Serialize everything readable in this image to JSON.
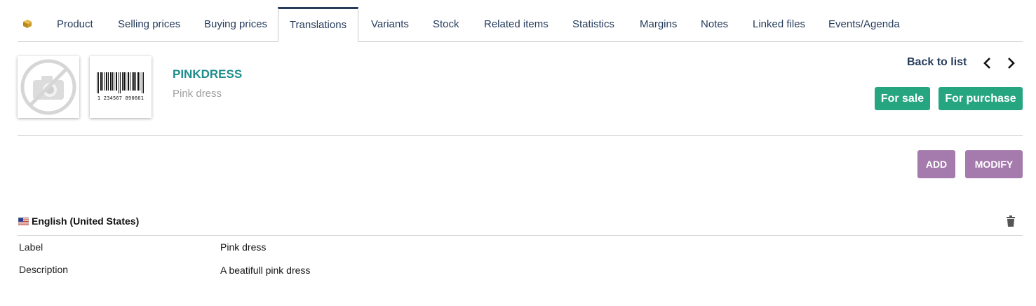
{
  "tabs": [
    {
      "label": "Product"
    },
    {
      "label": "Selling prices"
    },
    {
      "label": "Buying prices"
    },
    {
      "label": "Translations"
    },
    {
      "label": "Variants"
    },
    {
      "label": "Stock"
    },
    {
      "label": "Related items"
    },
    {
      "label": "Statistics"
    },
    {
      "label": "Margins"
    },
    {
      "label": "Notes"
    },
    {
      "label": "Linked files"
    },
    {
      "label": "Events/Agenda"
    }
  ],
  "active_tab": "Translations",
  "product": {
    "ref": "PINKDRESS",
    "label": "Pink dress",
    "barcode_digits": "1 234567 890661"
  },
  "navigation": {
    "back_label": "Back to list"
  },
  "status": {
    "sale": "For sale",
    "purchase": "For purchase"
  },
  "actions": {
    "add": "ADD",
    "modify": "MODIFY"
  },
  "translation": {
    "language": "English (United States)",
    "rows": [
      {
        "label": "Label",
        "value": "Pink dress"
      },
      {
        "label": "Description",
        "value": "A beatifull pink dress"
      }
    ]
  },
  "icons": {
    "product": "box-icon",
    "no_photo": "camera-off-icon",
    "barcode": "barcode-icon",
    "prev": "chevron-left-icon",
    "next": "chevron-right-icon",
    "flag": "us-flag-icon",
    "delete": "trash-icon"
  },
  "colors": {
    "primary": "#263c5c",
    "ref": "#1f8d8d",
    "status_green": "#25a580",
    "action_purple": "#a57aac"
  }
}
